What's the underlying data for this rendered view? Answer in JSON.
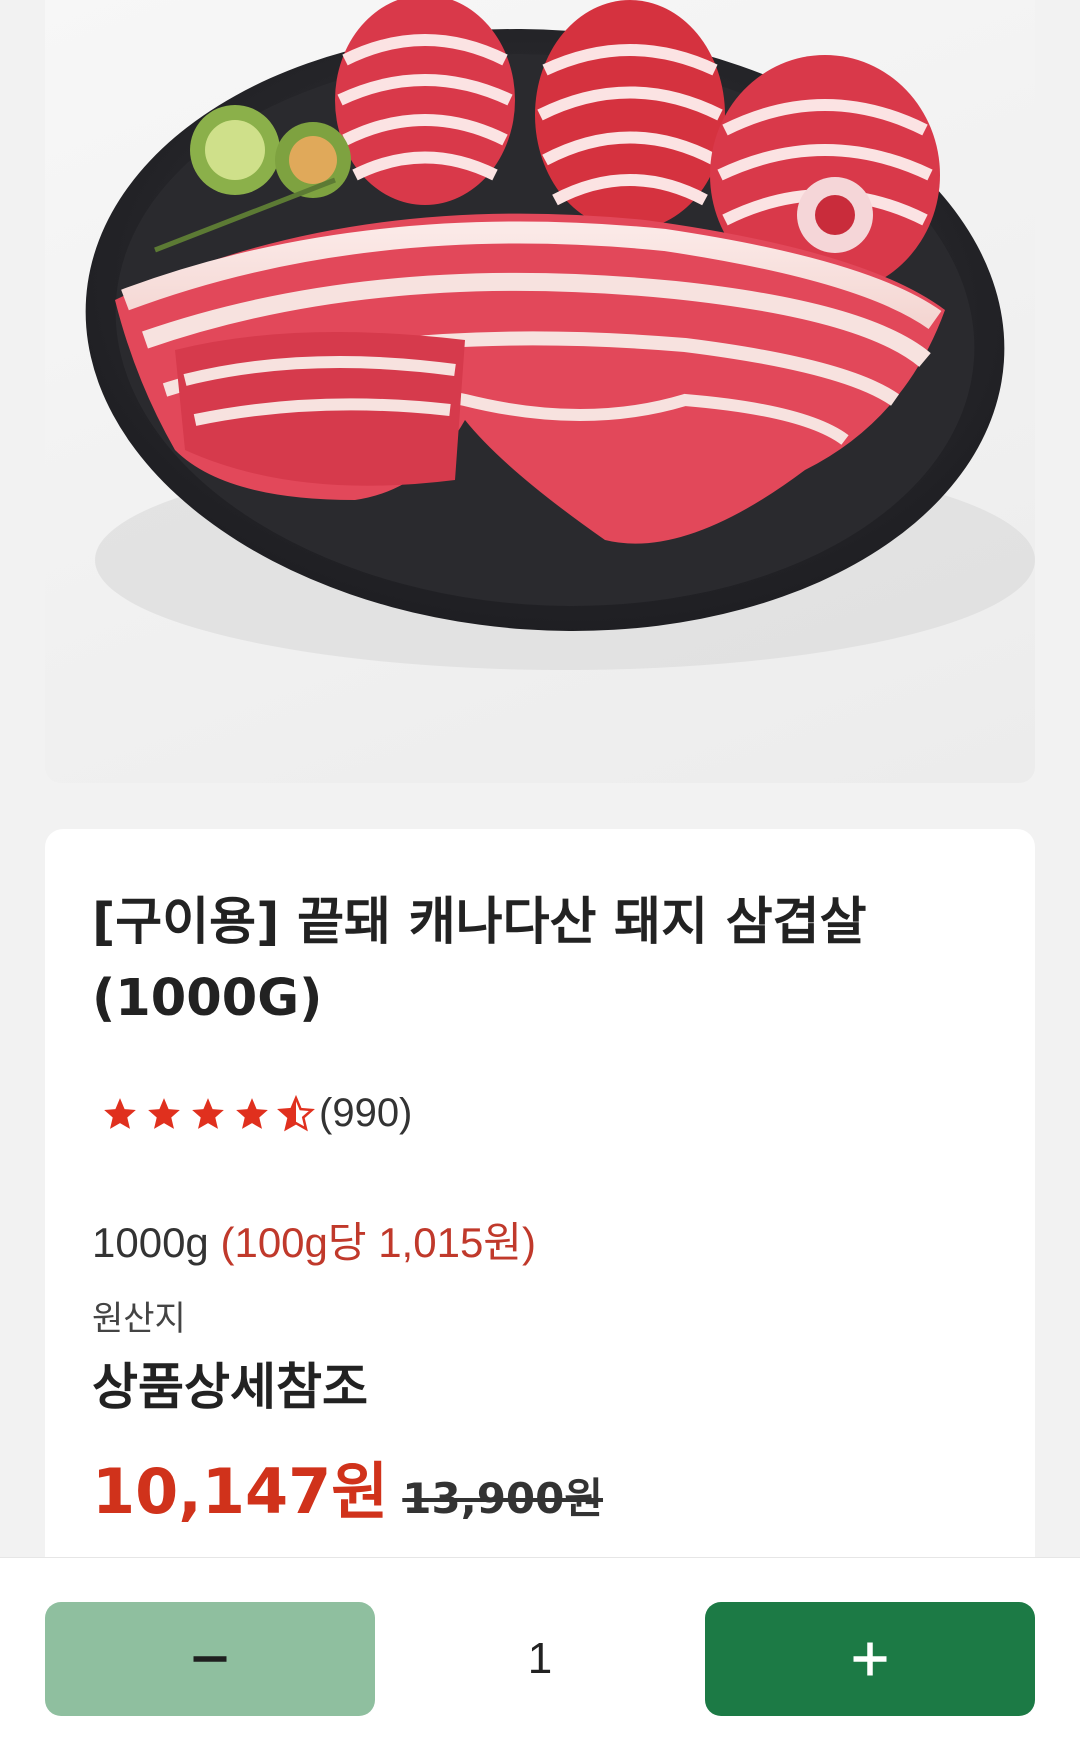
{
  "product": {
    "title": "[구이용] 끝돼 캐나다산 돼지 삼겹살 (1000G)",
    "rating": 4.5,
    "review_count": "(990)",
    "weight": "1000g",
    "unit_price": "(100g당 1,015원)",
    "origin_label": "원산지",
    "origin_value": "상품상세참조",
    "sale_price": "10,147원",
    "original_price": "13,900원"
  },
  "quantity": {
    "value": "1",
    "minus_icon": "minus-icon",
    "plus_icon": "plus-icon"
  },
  "colors": {
    "sale_red": "#d0321b",
    "star_red": "#e0301e",
    "plus_green": "#1c7a45",
    "minus_green": "#8fbf9f"
  }
}
